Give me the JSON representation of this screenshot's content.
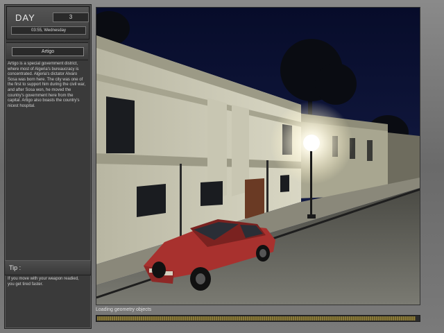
{
  "sidebar": {
    "day_label": "DAY",
    "day_value": "3",
    "datetime": "03:55, Wednesday",
    "location_name": "Artigo",
    "description": "Artigo is a special government district, where most of Algeria's bureaucracy is concentrated. Algeria's dictator Alvaro Sosa was born here. The city was one of the first to support him during the civil war, and after Sosa won, he moved the country's government here from the capital. Artigo also boasts the country's nicest hospital.",
    "tip_label": "Tip :",
    "tip_text": "If you move with your weapon readied, you get tired faster."
  },
  "loading": {
    "text": "Loading geometry objects",
    "progress": 0.99
  },
  "colors": {
    "sky": "#0b1233",
    "car": "#a8312e",
    "lamp_glow": "#ffffff"
  }
}
